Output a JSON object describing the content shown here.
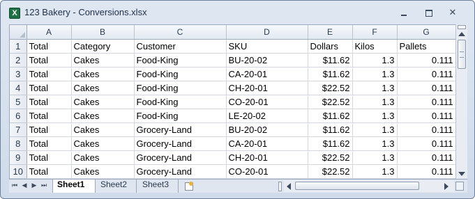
{
  "window": {
    "title": "123 Bakery - Conversions.xlsx",
    "icon": "excel-icon",
    "close_glyph": "✕"
  },
  "columns": [
    "A",
    "B",
    "C",
    "D",
    "E",
    "F",
    "G"
  ],
  "row_numbers": [
    "1",
    "2",
    "3",
    "4",
    "5",
    "6",
    "7",
    "8",
    "9",
    "10"
  ],
  "rows": [
    [
      "Total",
      "Category",
      "Customer",
      "SKU",
      "Dollars",
      "Kilos",
      "Pallets"
    ],
    [
      "Total",
      "Cakes",
      "Food-King",
      "BU-20-02",
      "$11.62",
      "1.3",
      "0.111"
    ],
    [
      "Total",
      "Cakes",
      "Food-King",
      "CA-20-01",
      "$11.62",
      "1.3",
      "0.111"
    ],
    [
      "Total",
      "Cakes",
      "Food-King",
      "CH-20-01",
      "$22.52",
      "1.3",
      "0.111"
    ],
    [
      "Total",
      "Cakes",
      "Food-King",
      "CO-20-01",
      "$22.52",
      "1.3",
      "0.111"
    ],
    [
      "Total",
      "Cakes",
      "Food-King",
      "LE-20-02",
      "$11.62",
      "1.3",
      "0.111"
    ],
    [
      "Total",
      "Cakes",
      "Grocery-Land",
      "BU-20-02",
      "$11.62",
      "1.3",
      "0.111"
    ],
    [
      "Total",
      "Cakes",
      "Grocery-Land",
      "CA-20-01",
      "$11.62",
      "1.3",
      "0.111"
    ],
    [
      "Total",
      "Cakes",
      "Grocery-Land",
      "CH-20-01",
      "$22.52",
      "1.3",
      "0.111"
    ],
    [
      "Total",
      "Cakes",
      "Grocery-Land",
      "CO-20-01",
      "$22.52",
      "1.3",
      "0.111"
    ]
  ],
  "sheet_tabs": [
    "Sheet1",
    "Sheet2",
    "Sheet3"
  ],
  "active_sheet": "Sheet1",
  "nav_glyphs": {
    "first": "⏮",
    "prev": "◀",
    "next": "▶",
    "last": "⏭"
  }
}
